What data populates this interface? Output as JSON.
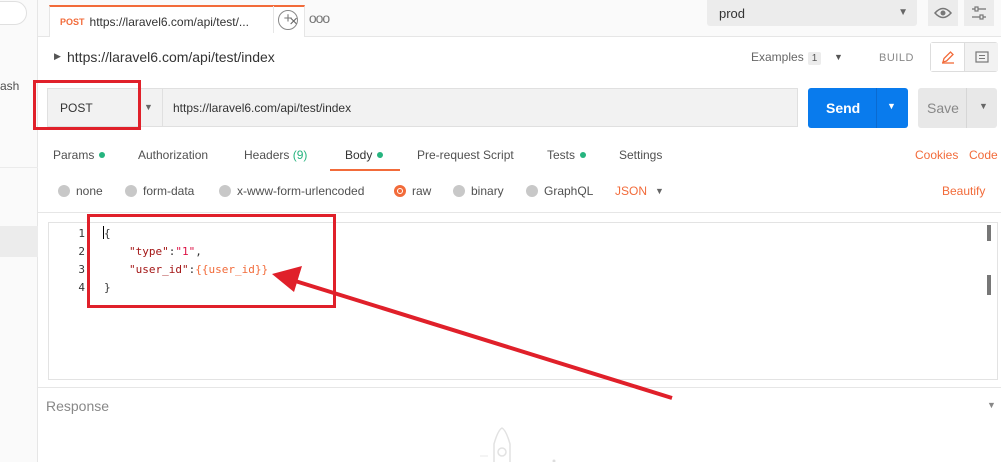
{
  "left": {
    "partial_label": "ash"
  },
  "tab": {
    "method": "POST",
    "title": "https://laravel6.com/api/test/...",
    "close_glyph": "×",
    "add_glyph": "+",
    "more_glyph": "ooo"
  },
  "environment": {
    "selected": "prod"
  },
  "request": {
    "name": "https://laravel6.com/api/test/index",
    "examples_label": "Examples",
    "examples_count": "1",
    "build_label": "BUILD",
    "method": "POST",
    "url": "https://laravel6.com/api/test/index",
    "send_label": "Send",
    "save_label": "Save"
  },
  "req_tabs": {
    "params": "Params",
    "authorization": "Authorization",
    "headers": "Headers",
    "headers_count": "(9)",
    "body": "Body",
    "prerequest": "Pre-request Script",
    "tests": "Tests",
    "settings": "Settings",
    "cookies": "Cookies",
    "code": "Code"
  },
  "body_types": {
    "none": "none",
    "form_data": "form-data",
    "urlencoded": "x-www-form-urlencoded",
    "raw": "raw",
    "binary": "binary",
    "graphql": "GraphQL",
    "format": "JSON",
    "beautify": "Beautify",
    "selected": "raw"
  },
  "editor": {
    "line_numbers": [
      "1",
      "2",
      "3",
      "4"
    ],
    "line1": "{",
    "line2_key": "\"type\"",
    "line2_sep": ":",
    "line2_val": "\"1\"",
    "line2_end": ",",
    "line3_key": "\"user_id\"",
    "line3_sep": ":",
    "line3_val": "{{user_id}}",
    "line4": "}"
  },
  "response": {
    "label": "Response"
  },
  "colors": {
    "accent": "#f26b3a",
    "send": "#097bed",
    "ok_dot": "#26b47f",
    "annotation": "#e0202a"
  },
  "icons": [
    "chevron-down-icon",
    "eye-icon",
    "sliders-icon",
    "pencil-icon",
    "document-icon",
    "plus-circle-icon",
    "rocket-icon"
  ]
}
